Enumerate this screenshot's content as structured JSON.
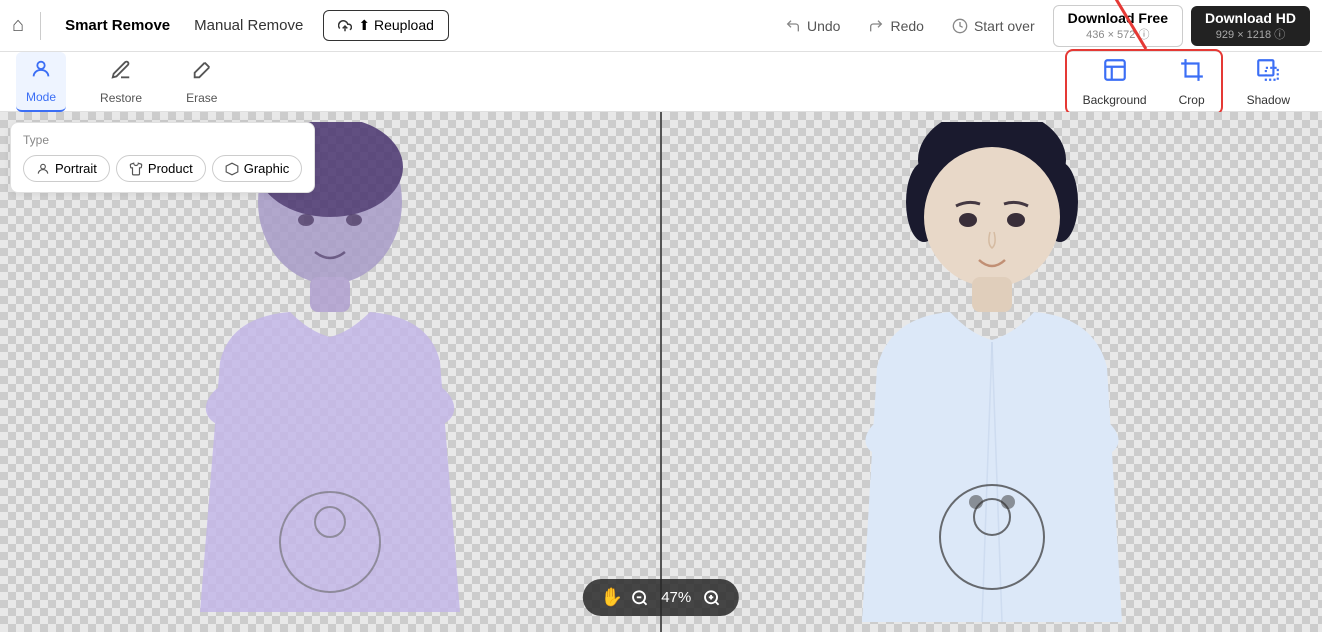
{
  "header": {
    "home_icon": "🏠",
    "smart_remove_label": "Smart Remove",
    "manual_remove_label": "Manual Remove",
    "reupload_label": "⬆ Reupload",
    "undo_label": "Undo",
    "redo_label": "Redo",
    "start_over_label": "Start over",
    "download_free_label": "Download Free",
    "download_free_size": "436 × 572 ⓘ",
    "download_hd_label": "Download HD",
    "download_hd_size": "929 × 1218 ⓘ"
  },
  "toolbar": {
    "mode_label": "Mode",
    "restore_label": "Restore",
    "erase_label": "Erase",
    "background_label": "Background",
    "crop_label": "Crop",
    "shadow_label": "Shadow"
  },
  "type_panel": {
    "label": "Type",
    "options": [
      {
        "id": "portrait",
        "label": "Portrait",
        "icon": "👤"
      },
      {
        "id": "product",
        "label": "Product",
        "icon": "👕"
      },
      {
        "id": "graphic",
        "label": "Graphic",
        "icon": "⬡"
      }
    ]
  },
  "zoom": {
    "level": "47%",
    "hand_icon": "✋",
    "zoom_in_icon": "⊕",
    "zoom_out_icon": "⊖"
  },
  "colors": {
    "accent": "#3b6ef5",
    "highlight_border": "#e53935",
    "bg_checked": "#e0e0e0"
  }
}
